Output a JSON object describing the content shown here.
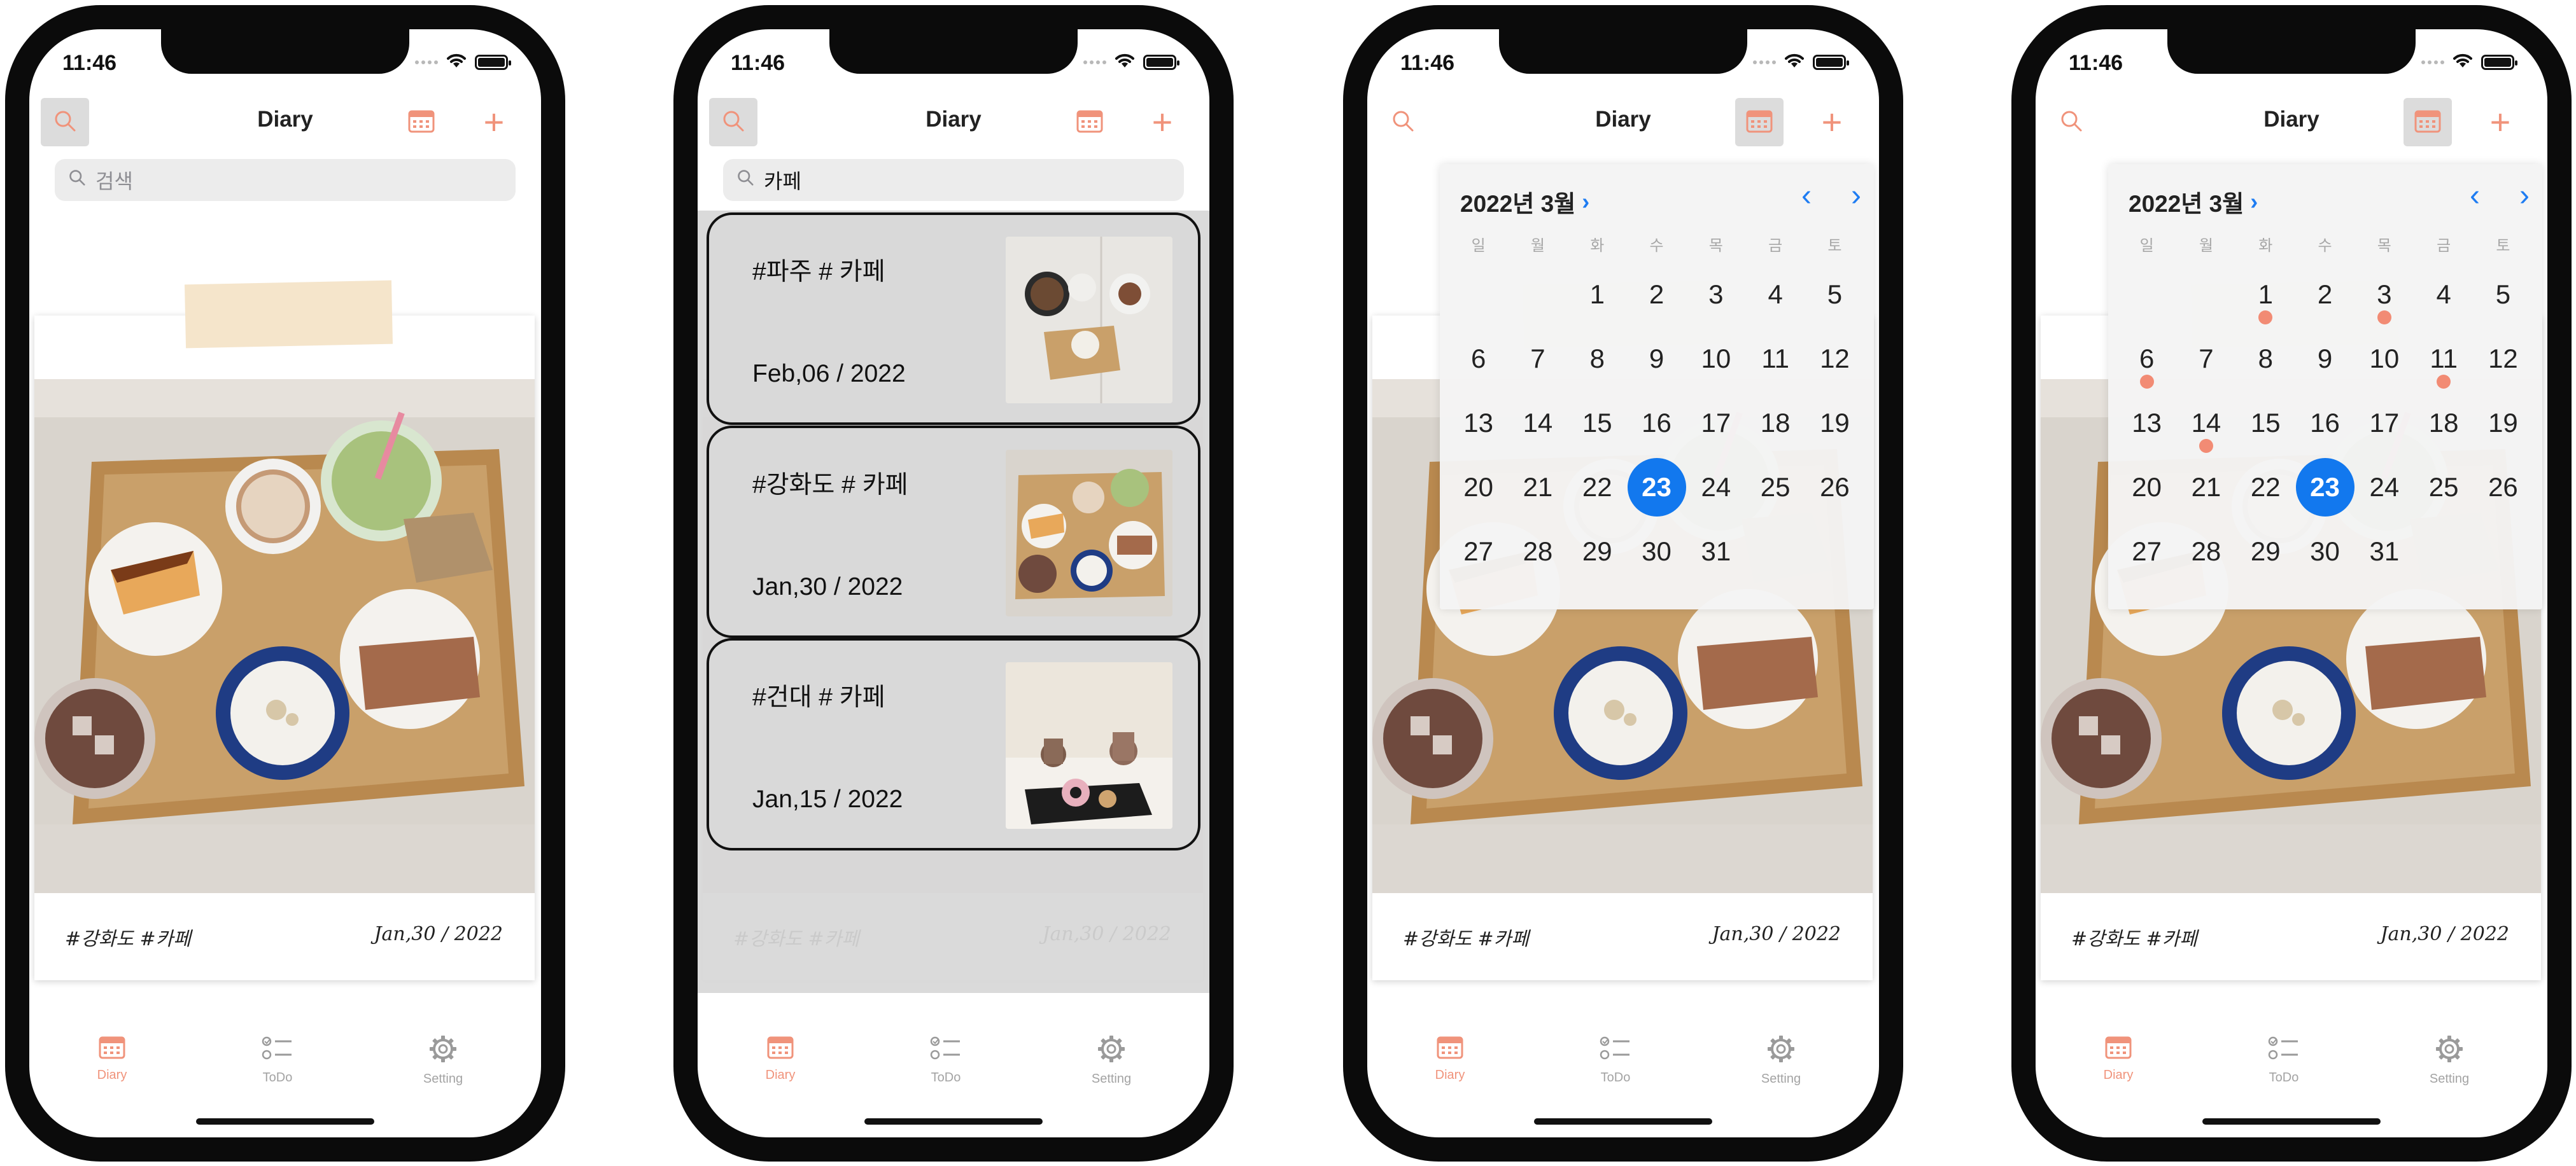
{
  "status_time": "11:46",
  "nav_title": "Diary",
  "search_placeholder": "검색",
  "search_query": "카페",
  "diary_card": {
    "tags": "#강화도 #카페",
    "date": "Jan,30 / 2022"
  },
  "results": [
    {
      "tags": "#파주 # 카페",
      "date": "Feb,06 / 2022"
    },
    {
      "tags": "#강화도 # 카페",
      "date": "Jan,30 / 2022"
    },
    {
      "tags": "#건대 # 카페",
      "date": "Jan,15 / 2022"
    }
  ],
  "calendar": {
    "month_label": "2022년 3월",
    "weekdays": [
      "일",
      "월",
      "화",
      "수",
      "목",
      "금",
      "토"
    ],
    "leading_blanks": 2,
    "days_in_month": 31,
    "selected_day": 23,
    "marked_days": [
      1,
      3,
      6,
      11,
      14
    ]
  },
  "tabs": [
    "Diary",
    "ToDo",
    "Setting"
  ],
  "icons": [
    "search-icon",
    "calendar-icon",
    "plus-icon",
    "diary-tab-icon",
    "todo-tab-icon",
    "setting-tab-icon"
  ],
  "colors": {
    "accent": "#f0937b",
    "selected": "#1278ee",
    "marker": "#f28b74"
  }
}
